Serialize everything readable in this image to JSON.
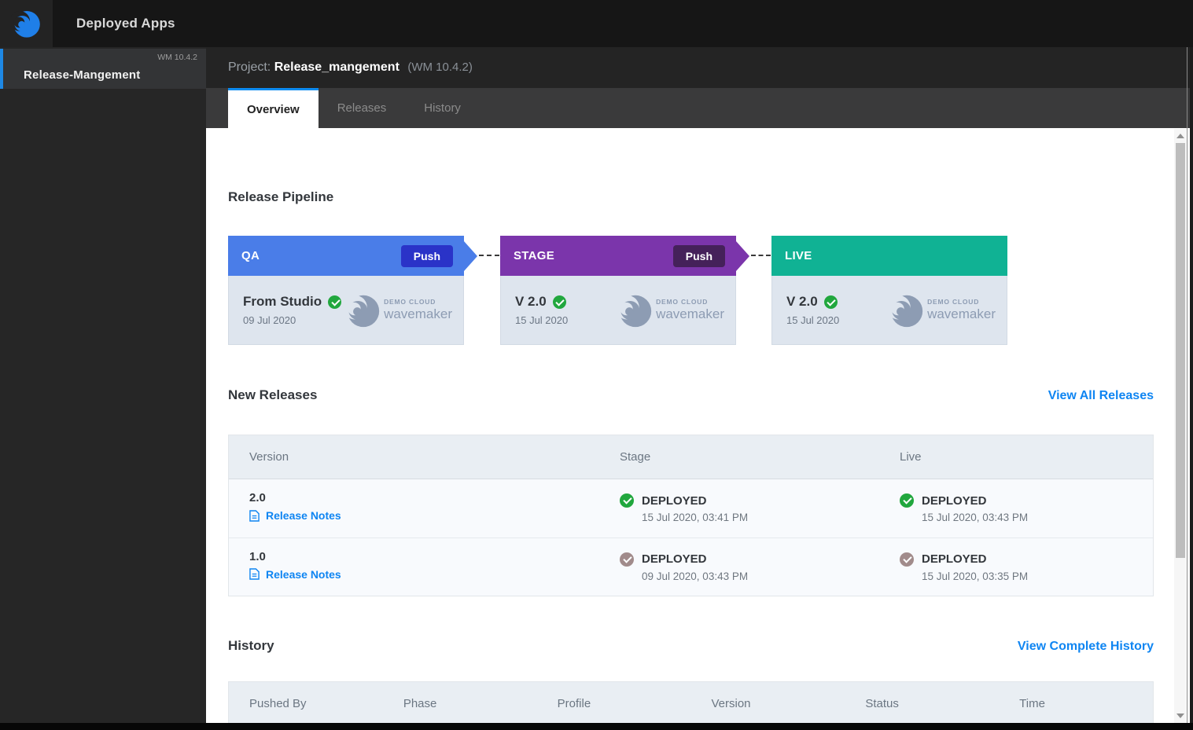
{
  "topbar": {
    "app_title": "Deployed Apps"
  },
  "sidebar": {
    "project_item": {
      "label": "Release-Mangement",
      "version": "WM 10.4.2"
    }
  },
  "header": {
    "project_label": "Project:",
    "project_name": "Release_mangement",
    "project_version": "(WM 10.4.2)"
  },
  "tabs": [
    {
      "label": "Overview",
      "active": true
    },
    {
      "label": "Releases",
      "active": false
    },
    {
      "label": "History",
      "active": false
    }
  ],
  "pipeline": {
    "title": "Release Pipeline",
    "logo": {
      "top": "DEMO CLOUD",
      "bottom": "wavemaker"
    },
    "stages": [
      {
        "name": "QA",
        "color": "#4a7de8",
        "button_color": "#2a33c8",
        "push_label": "Push",
        "version": "From Studio",
        "date": "09 Jul 2020"
      },
      {
        "name": "STAGE",
        "color": "#7b35ab",
        "button_color": "#45215a",
        "push_label": "Push",
        "version": "V 2.0",
        "date": "15 Jul 2020"
      },
      {
        "name": "LIVE",
        "color": "#10b294",
        "version": "V 2.0",
        "date": "15 Jul 2020"
      }
    ]
  },
  "new_releases": {
    "title": "New Releases",
    "view_all_label": "View All Releases",
    "columns": {
      "version": "Version",
      "stage": "Stage",
      "live": "Live"
    },
    "rows": [
      {
        "version": "2.0",
        "notes_label": "Release Notes",
        "stage": {
          "status": "DEPLOYED",
          "time": "15 Jul 2020, 03:41 PM"
        },
        "live": {
          "status": "DEPLOYED",
          "time": "15 Jul 2020, 03:43 PM"
        }
      },
      {
        "version": "1.0",
        "notes_label": "Release Notes",
        "stage": {
          "status": "DEPLOYED",
          "time": "09 Jul 2020, 03:43 PM"
        },
        "live": {
          "status": "DEPLOYED",
          "time": "15 Jul 2020, 03:35 PM"
        }
      }
    ]
  },
  "history": {
    "title": "History",
    "view_all_label": "View Complete History",
    "columns": [
      "Pushed By",
      "Phase",
      "Profile",
      "Version",
      "Status",
      "Time"
    ]
  },
  "colors": {
    "accent_blue": "#0f85f2",
    "check_green": "#21a73e",
    "check_muted": "#a18b8b"
  }
}
